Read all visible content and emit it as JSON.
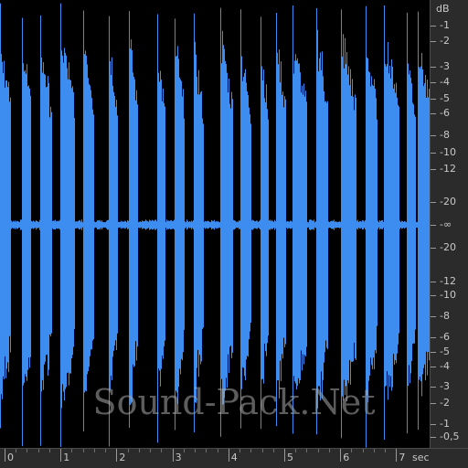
{
  "colors": {
    "waveform": "#3d8cf0",
    "background": "#000000",
    "ruler_bg": "#2b2b2b",
    "ruler_text": "#c8c8c8"
  },
  "db_ruler": {
    "unit": "dB",
    "top_labels": [
      "-1",
      "-2",
      "-3",
      "-4",
      "-5",
      "-6",
      "-8",
      "-10",
      "-12",
      "-20"
    ],
    "center_label": "-∞",
    "bottom_labels": [
      "-20",
      "-12",
      "-10",
      "-8",
      "-6",
      "-5",
      "-4",
      "-3",
      "-2",
      "-1",
      "-0,5"
    ]
  },
  "time_ruler": {
    "unit": "sec",
    "labels": [
      "0",
      "1",
      "2",
      "3",
      "4",
      "5",
      "6",
      "7"
    ]
  },
  "watermark": {
    "text": "Sound-Pack.Net"
  },
  "waveform": {
    "duration_sec": 7.5,
    "bursts_sec": [
      [
        0.0,
        0.18
      ],
      [
        0.38,
        0.52
      ],
      [
        0.7,
        0.9
      ],
      [
        1.05,
        1.3
      ],
      [
        1.45,
        1.62
      ],
      [
        1.9,
        2.05
      ],
      [
        2.25,
        2.4
      ],
      [
        2.75,
        2.88
      ],
      [
        3.05,
        3.2
      ],
      [
        3.38,
        3.55
      ],
      [
        3.85,
        4.05
      ],
      [
        4.2,
        4.38
      ],
      [
        4.55,
        4.68
      ],
      [
        4.82,
        4.98
      ],
      [
        5.1,
        5.35
      ],
      [
        5.52,
        5.72
      ],
      [
        5.95,
        6.2
      ],
      [
        6.38,
        6.58
      ],
      [
        6.7,
        6.95
      ],
      [
        7.1,
        7.25
      ],
      [
        7.3,
        7.5
      ]
    ]
  }
}
